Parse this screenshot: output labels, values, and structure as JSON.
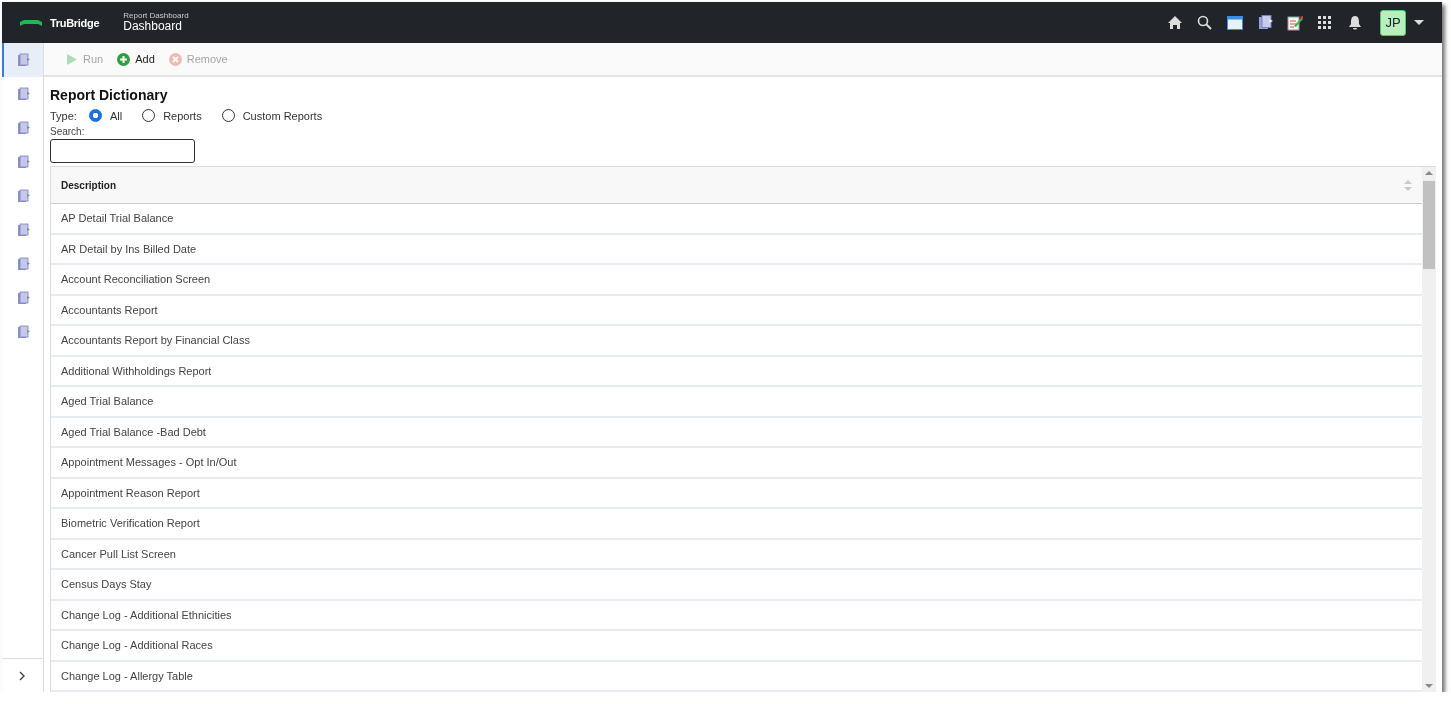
{
  "header": {
    "brand": "TruBridge",
    "subtitle": "Report Dashboard",
    "title": "Dashboard",
    "user_initials": "JP"
  },
  "sidebar": {
    "items": [
      {
        "selected": true
      },
      {
        "selected": false
      },
      {
        "selected": false
      },
      {
        "selected": false
      },
      {
        "selected": false
      },
      {
        "selected": false
      },
      {
        "selected": false
      },
      {
        "selected": false
      },
      {
        "selected": false
      }
    ]
  },
  "toolbar": [
    {
      "kind": "run",
      "label": "Run",
      "disabled": true
    },
    {
      "kind": "add",
      "label": "Add",
      "disabled": false
    },
    {
      "kind": "remove",
      "label": "Remove",
      "disabled": true
    }
  ],
  "page_title": "Report Dictionary",
  "type_filter": {
    "label": "Type:",
    "options": [
      {
        "label": "All",
        "selected": true
      },
      {
        "label": "Reports",
        "selected": false
      },
      {
        "label": "Custom Reports",
        "selected": false
      }
    ]
  },
  "search": {
    "label": "Search:"
  },
  "table": {
    "columns": [
      "Description"
    ],
    "rows": [
      "AP Detail Trial Balance",
      "AR Detail by Ins Billed Date",
      "Account Reconciliation Screen",
      "Accountants Report",
      "Accountants Report by Financial Class",
      "Additional Withholdings Report",
      "Aged Trial Balance",
      "Aged Trial Balance -Bad Debt",
      "Appointment Messages - Opt In/Out",
      "Appointment Reason Report",
      "Biometric Verification Report",
      "Cancer Pull List Screen",
      "Census Days Stay",
      "Change Log - Additional Ethnicities",
      "Change Log - Additional Races",
      "Change Log - Allergy Table"
    ]
  }
}
